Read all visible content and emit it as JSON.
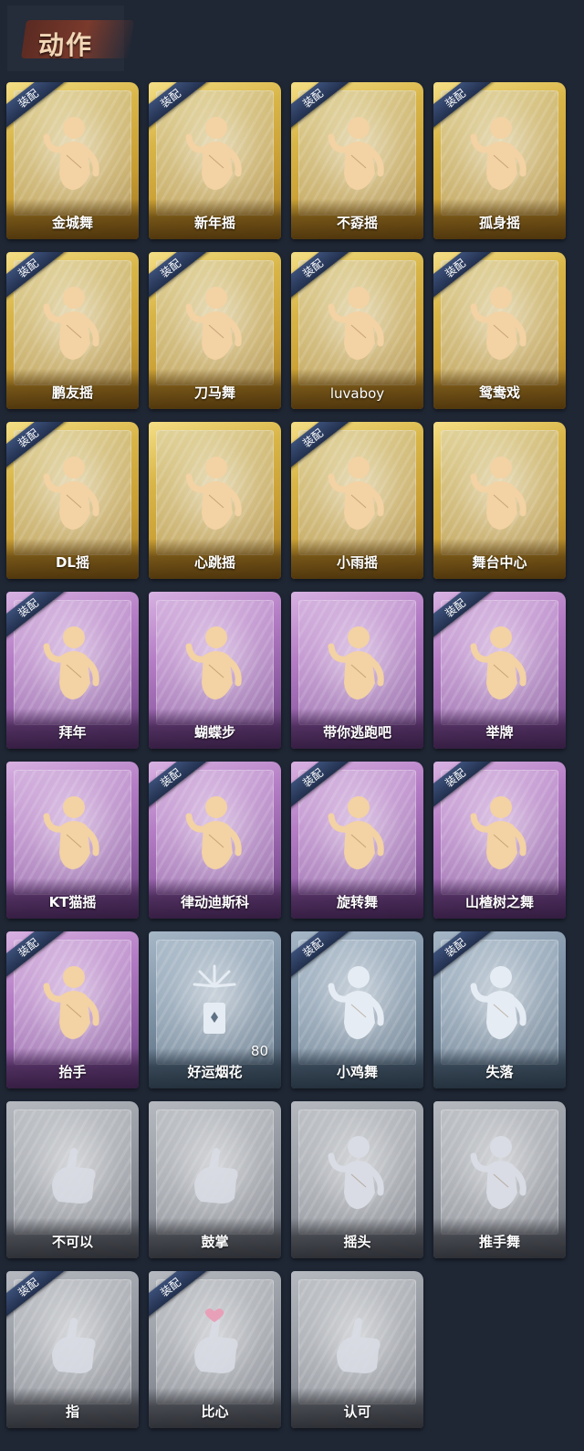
{
  "header": {
    "title": "动作"
  },
  "equipped_tag": "装配",
  "cards": [
    {
      "label": "金城舞",
      "tier": "gold",
      "equipped": true,
      "icon": "dancer-sparkle-icon"
    },
    {
      "label": "新年摇",
      "tier": "gold",
      "equipped": true,
      "icon": "dancer-music-icon"
    },
    {
      "label": "不孬摇",
      "tier": "gold",
      "equipped": true,
      "icon": "dancer-raised-arm-icon"
    },
    {
      "label": "孤身摇",
      "tier": "gold",
      "equipped": true,
      "icon": "dancer-stars-icon"
    },
    {
      "label": "鹏友摇",
      "tier": "gold",
      "equipped": true,
      "icon": "dancer-sparkle-icon"
    },
    {
      "label": "刀马舞",
      "tier": "gold",
      "equipped": true,
      "icon": "dancer-music-icon"
    },
    {
      "label": "luvaboy",
      "tier": "gold",
      "equipped": true,
      "icon": "dancer-point-icon"
    },
    {
      "label": "鸳鸯戏",
      "tier": "gold",
      "equipped": true,
      "icon": "dancer-music-icon"
    },
    {
      "label": "DL摇",
      "tier": "gold",
      "equipped": true,
      "icon": "dancer-raised-arm-icon"
    },
    {
      "label": "心跳摇",
      "tier": "gold",
      "equipped": false,
      "icon": "dancer-music-icon"
    },
    {
      "label": "小雨摇",
      "tier": "gold",
      "equipped": true,
      "icon": "dancer-music-icon"
    },
    {
      "label": "舞台中心",
      "tier": "gold",
      "equipped": false,
      "icon": "dancer-sparkle-icon"
    },
    {
      "label": "拜年",
      "tier": "purple",
      "equipped": true,
      "icon": "figure-bow-icon"
    },
    {
      "label": "蝴蝶步",
      "tier": "purple",
      "equipped": false,
      "icon": "dancer-point-icon"
    },
    {
      "label": "带你逃跑吧",
      "tier": "purple",
      "equipped": false,
      "icon": "dancer-music-icon"
    },
    {
      "label": "举牌",
      "tier": "purple",
      "equipped": true,
      "icon": "figure-sign-icon"
    },
    {
      "label": "KT猫摇",
      "tier": "purple",
      "equipped": false,
      "icon": "dancer-music-icon"
    },
    {
      "label": "律动迪斯科",
      "tier": "purple",
      "equipped": true,
      "icon": "dancer-raised-arm-icon"
    },
    {
      "label": "旋转舞",
      "tier": "purple",
      "equipped": true,
      "icon": "dancer-spin-icon"
    },
    {
      "label": "山楂树之舞",
      "tier": "purple",
      "equipped": true,
      "icon": "dancer-raised-arm-icon"
    },
    {
      "label": "抬手",
      "tier": "purple",
      "equipped": true,
      "icon": "figure-raise-hand-icon"
    },
    {
      "label": "好运烟花",
      "tier": "blue",
      "equipped": false,
      "icon": "firework-icon",
      "count": "80"
    },
    {
      "label": "小鸡舞",
      "tier": "blue",
      "equipped": true,
      "icon": "figure-chicken-icon"
    },
    {
      "label": "失落",
      "tier": "blue",
      "equipped": true,
      "icon": "figure-crawl-icon"
    },
    {
      "label": "不可以",
      "tier": "gray",
      "equipped": false,
      "icon": "finger-wag-icon"
    },
    {
      "label": "鼓掌",
      "tier": "gray",
      "equipped": false,
      "icon": "clap-icon"
    },
    {
      "label": "摇头",
      "tier": "gray",
      "equipped": false,
      "icon": "figure-shake-head-icon"
    },
    {
      "label": "推手舞",
      "tier": "gray",
      "equipped": false,
      "icon": "figure-push-hands-icon"
    },
    {
      "label": "指",
      "tier": "gray",
      "equipped": true,
      "icon": "pointing-hand-icon"
    },
    {
      "label": "比心",
      "tier": "gray",
      "equipped": true,
      "icon": "finger-heart-icon"
    },
    {
      "label": "认可",
      "tier": "gray",
      "equipped": false,
      "icon": "thumbs-up-icon"
    }
  ]
}
